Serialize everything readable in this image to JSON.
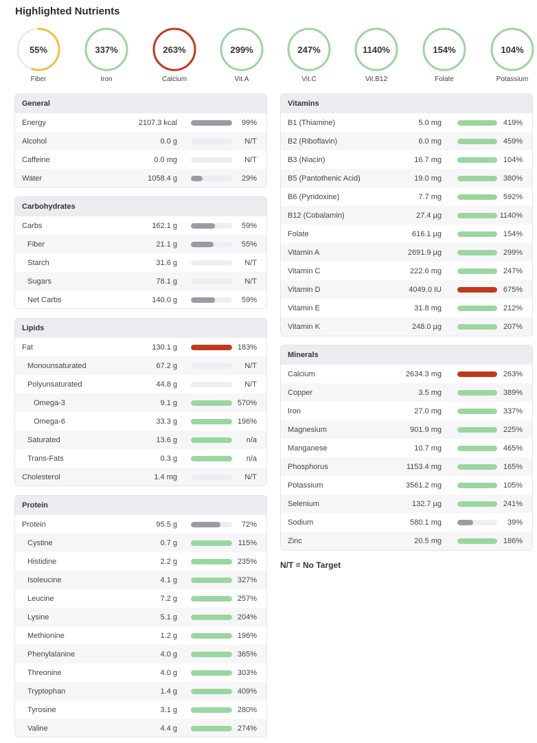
{
  "title": "Highlighted Nutrients",
  "colors": {
    "green": "#9ad79f",
    "red": "#c2381c",
    "gray": "#9a9ca5",
    "yellow": "#f0c23b",
    "track": "#eeeef2"
  },
  "rings": [
    {
      "label": "Fiber",
      "pct": "55%",
      "value": 55,
      "color": "yellow"
    },
    {
      "label": "Iron",
      "pct": "337%",
      "value": 337,
      "color": "green"
    },
    {
      "label": "Calcium",
      "pct": "263%",
      "value": 263,
      "color": "red"
    },
    {
      "label": "Vit.A",
      "pct": "299%",
      "value": 299,
      "color": "green"
    },
    {
      "label": "Vit.C",
      "pct": "247%",
      "value": 247,
      "color": "green"
    },
    {
      "label": "Vit.B12",
      "pct": "1140%",
      "value": 1140,
      "color": "green"
    },
    {
      "label": "Folate",
      "pct": "154%",
      "value": 154,
      "color": "green"
    },
    {
      "label": "Potassium",
      "pct": "104%",
      "value": 104,
      "color": "green"
    }
  ],
  "panels": {
    "general": {
      "title": "General",
      "rows": [
        {
          "name": "Energy",
          "value": "2107.3 kcal",
          "pct": "99%",
          "fill": 1.0,
          "color": "gray"
        },
        {
          "name": "Alcohol",
          "value": "0.0 g",
          "pct": "N/T",
          "fill": 0,
          "color": "gray"
        },
        {
          "name": "Caffeine",
          "value": "0.0 mg",
          "pct": "N/T",
          "fill": 0,
          "color": "gray"
        },
        {
          "name": "Water",
          "value": "1058.4 g",
          "pct": "29%",
          "fill": 0.29,
          "color": "gray"
        }
      ]
    },
    "carbohydrates": {
      "title": "Carbohydrates",
      "rows": [
        {
          "name": "Carbs",
          "value": "162.1 g",
          "pct": "59%",
          "fill": 0.59,
          "color": "gray",
          "indent": 0
        },
        {
          "name": "Fiber",
          "value": "21.1 g",
          "pct": "55%",
          "fill": 0.55,
          "color": "gray",
          "indent": 1
        },
        {
          "name": "Starch",
          "value": "31.6 g",
          "pct": "N/T",
          "fill": 0,
          "color": "gray",
          "indent": 1
        },
        {
          "name": "Sugars",
          "value": "78.1 g",
          "pct": "N/T",
          "fill": 0,
          "color": "gray",
          "indent": 1
        },
        {
          "name": "Net Carbs",
          "value": "140.0 g",
          "pct": "59%",
          "fill": 0.59,
          "color": "gray",
          "indent": 1
        }
      ]
    },
    "lipids": {
      "title": "Lipids",
      "rows": [
        {
          "name": "Fat",
          "value": "130.1 g",
          "pct": "183%",
          "fill": 1.0,
          "color": "red",
          "indent": 0
        },
        {
          "name": "Monounsaturated",
          "value": "67.2 g",
          "pct": "N/T",
          "fill": 0,
          "color": "gray",
          "indent": 1
        },
        {
          "name": "Polyunsaturated",
          "value": "44.8 g",
          "pct": "N/T",
          "fill": 0,
          "color": "gray",
          "indent": 1
        },
        {
          "name": "Omega-3",
          "value": "9.1 g",
          "pct": "570%",
          "fill": 1.0,
          "color": "green",
          "indent": 2
        },
        {
          "name": "Omega-6",
          "value": "33.3 g",
          "pct": "196%",
          "fill": 1.0,
          "color": "green",
          "indent": 2
        },
        {
          "name": "Saturated",
          "value": "13.6 g",
          "pct": "n/a",
          "fill": 1.0,
          "color": "green",
          "indent": 1
        },
        {
          "name": "Trans-Fats",
          "value": "0.3 g",
          "pct": "n/a",
          "fill": 1.0,
          "color": "green",
          "indent": 1
        },
        {
          "name": "Cholesterol",
          "value": "1.4 mg",
          "pct": "N/T",
          "fill": 0,
          "color": "gray",
          "indent": 0
        }
      ]
    },
    "protein": {
      "title": "Protein",
      "rows": [
        {
          "name": "Protein",
          "value": "95.5 g",
          "pct": "72%",
          "fill": 0.72,
          "color": "gray",
          "indent": 0
        },
        {
          "name": "Cystine",
          "value": "0.7 g",
          "pct": "115%",
          "fill": 1.0,
          "color": "green",
          "indent": 1
        },
        {
          "name": "Histidine",
          "value": "2.2 g",
          "pct": "235%",
          "fill": 1.0,
          "color": "green",
          "indent": 1
        },
        {
          "name": "Isoleucine",
          "value": "4.1 g",
          "pct": "327%",
          "fill": 1.0,
          "color": "green",
          "indent": 1
        },
        {
          "name": "Leucine",
          "value": "7.2 g",
          "pct": "257%",
          "fill": 1.0,
          "color": "green",
          "indent": 1
        },
        {
          "name": "Lysine",
          "value": "5.1 g",
          "pct": "204%",
          "fill": 1.0,
          "color": "green",
          "indent": 1
        },
        {
          "name": "Methionine",
          "value": "1.2 g",
          "pct": "196%",
          "fill": 1.0,
          "color": "green",
          "indent": 1
        },
        {
          "name": "Phenylalanine",
          "value": "4.0 g",
          "pct": "365%",
          "fill": 1.0,
          "color": "green",
          "indent": 1
        },
        {
          "name": "Threonine",
          "value": "4.0 g",
          "pct": "303%",
          "fill": 1.0,
          "color": "green",
          "indent": 1
        },
        {
          "name": "Tryptophan",
          "value": "1.4 g",
          "pct": "409%",
          "fill": 1.0,
          "color": "green",
          "indent": 1
        },
        {
          "name": "Tyrosine",
          "value": "3.1 g",
          "pct": "280%",
          "fill": 1.0,
          "color": "green",
          "indent": 1
        },
        {
          "name": "Valine",
          "value": "4.4 g",
          "pct": "274%",
          "fill": 1.0,
          "color": "green",
          "indent": 1
        }
      ]
    },
    "vitamins": {
      "title": "Vitamins",
      "rows": [
        {
          "name": "B1 (Thiamine)",
          "value": "5.0 mg",
          "pct": "419%",
          "fill": 1.0,
          "color": "green"
        },
        {
          "name": "B2 (Riboflavin)",
          "value": "6.0 mg",
          "pct": "459%",
          "fill": 1.0,
          "color": "green"
        },
        {
          "name": "B3 (Niacin)",
          "value": "16.7 mg",
          "pct": "104%",
          "fill": 1.0,
          "color": "green"
        },
        {
          "name": "B5 (Pantothenic Acid)",
          "value": "19.0 mg",
          "pct": "380%",
          "fill": 1.0,
          "color": "green"
        },
        {
          "name": "B6 (Pyridoxine)",
          "value": "7.7 mg",
          "pct": "592%",
          "fill": 1.0,
          "color": "green"
        },
        {
          "name": "B12 (Cobalamin)",
          "value": "27.4 µg",
          "pct": "1140%",
          "fill": 1.0,
          "color": "green"
        },
        {
          "name": "Folate",
          "value": "616.1 µg",
          "pct": "154%",
          "fill": 1.0,
          "color": "green"
        },
        {
          "name": "Vitamin A",
          "value": "2691.9 µg",
          "pct": "299%",
          "fill": 1.0,
          "color": "green"
        },
        {
          "name": "Vitamin C",
          "value": "222.6 mg",
          "pct": "247%",
          "fill": 1.0,
          "color": "green"
        },
        {
          "name": "Vitamin D",
          "value": "4049.0 IU",
          "pct": "675%",
          "fill": 1.0,
          "color": "red"
        },
        {
          "name": "Vitamin E",
          "value": "31.8 mg",
          "pct": "212%",
          "fill": 1.0,
          "color": "green"
        },
        {
          "name": "Vitamin K",
          "value": "248.0 µg",
          "pct": "207%",
          "fill": 1.0,
          "color": "green"
        }
      ]
    },
    "minerals": {
      "title": "Minerals",
      "rows": [
        {
          "name": "Calcium",
          "value": "2634.3 mg",
          "pct": "263%",
          "fill": 1.0,
          "color": "red"
        },
        {
          "name": "Copper",
          "value": "3.5 mg",
          "pct": "389%",
          "fill": 1.0,
          "color": "green"
        },
        {
          "name": "Iron",
          "value": "27.0 mg",
          "pct": "337%",
          "fill": 1.0,
          "color": "green"
        },
        {
          "name": "Magnesium",
          "value": "901.9 mg",
          "pct": "225%",
          "fill": 1.0,
          "color": "green"
        },
        {
          "name": "Manganese",
          "value": "10.7 mg",
          "pct": "465%",
          "fill": 1.0,
          "color": "green"
        },
        {
          "name": "Phosphorus",
          "value": "1153.4 mg",
          "pct": "165%",
          "fill": 1.0,
          "color": "green"
        },
        {
          "name": "Potassium",
          "value": "3561.2 mg",
          "pct": "105%",
          "fill": 1.0,
          "color": "green"
        },
        {
          "name": "Selenium",
          "value": "132.7 µg",
          "pct": "241%",
          "fill": 1.0,
          "color": "green"
        },
        {
          "name": "Sodium",
          "value": "580.1 mg",
          "pct": "39%",
          "fill": 0.39,
          "color": "gray"
        },
        {
          "name": "Zinc",
          "value": "20.5 mg",
          "pct": "186%",
          "fill": 1.0,
          "color": "green"
        }
      ]
    }
  },
  "note": "N/T = No Target"
}
